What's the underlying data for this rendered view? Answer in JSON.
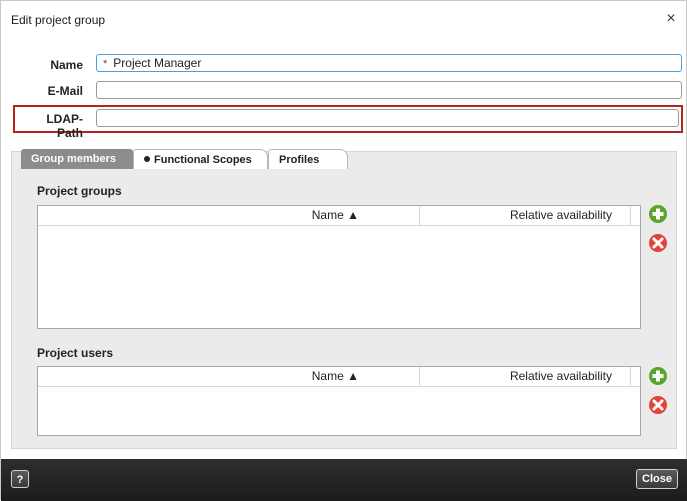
{
  "dialog": {
    "title": "Edit project group",
    "close_glyph": "×"
  },
  "form": {
    "name_label": "Name",
    "name_value": "Project Manager",
    "required_mark": "*",
    "email_label": "E-Mail",
    "email_value": "",
    "ldap_label": "LDAP-Path",
    "ldap_value": ""
  },
  "tabs": [
    {
      "label": "Group members",
      "active": true
    },
    {
      "label": "Functional Scopes",
      "active": false,
      "has_dot": true
    },
    {
      "label": "Profiles",
      "active": false
    }
  ],
  "project_groups": {
    "title": "Project groups",
    "columns": [
      "Name ▲",
      "Relative availability"
    ],
    "rows": []
  },
  "project_users": {
    "title": "Project users",
    "columns": [
      "Name ▲",
      "Relative availability"
    ],
    "rows": []
  },
  "icons": {
    "add": "add-icon",
    "remove": "remove-icon"
  },
  "footer": {
    "help_label": "?",
    "close_label": "Close"
  },
  "colors": {
    "add_green": "#5aa52a",
    "remove_red": "#e0453a",
    "highlight_red": "#b3261e",
    "active_tab": "#8c8c8c",
    "footer_bg": "#262626"
  }
}
